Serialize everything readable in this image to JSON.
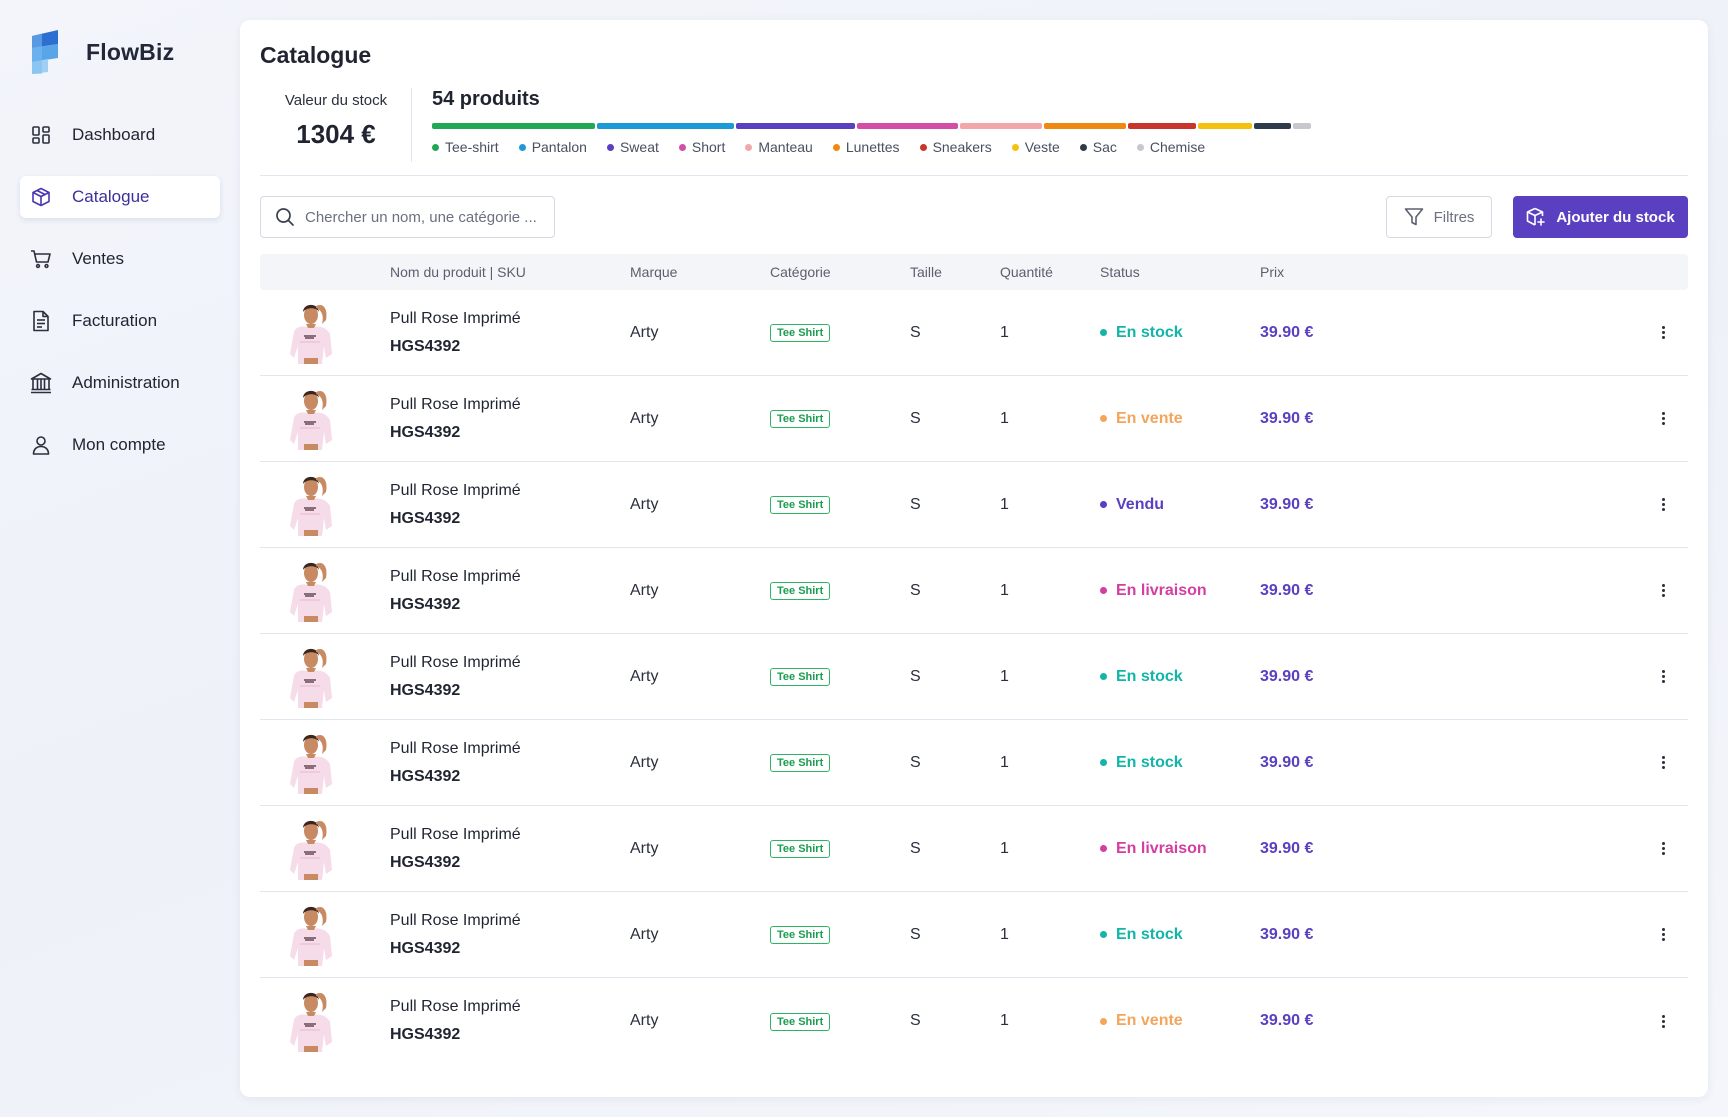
{
  "brand": {
    "name": "FlowBiz"
  },
  "nav": [
    {
      "label": "Dashboard",
      "icon": "dashboard-icon",
      "active": false
    },
    {
      "label": "Catalogue",
      "icon": "box-icon",
      "active": true
    },
    {
      "label": "Ventes",
      "icon": "cart-icon",
      "active": false
    },
    {
      "label": "Facturation",
      "icon": "document-icon",
      "active": false
    },
    {
      "label": "Administration",
      "icon": "bank-icon",
      "active": false
    },
    {
      "label": "Mon compte",
      "icon": "user-icon",
      "active": false
    }
  ],
  "page": {
    "title": "Catalogue"
  },
  "stock": {
    "label": "Valeur du stock",
    "value": "1304 €"
  },
  "products": {
    "count_label": "54 produits",
    "categories": [
      {
        "name": "Tee-shirt",
        "color": "#22a855",
        "share": 0.185
      },
      {
        "name": "Pantalon",
        "color": "#1c9ad6",
        "share": 0.155
      },
      {
        "name": "Sweat",
        "color": "#5a3fc0",
        "share": 0.135
      },
      {
        "name": "Short",
        "color": "#d24fa6",
        "share": 0.115
      },
      {
        "name": "Manteau",
        "color": "#f2a8a8",
        "share": 0.093
      },
      {
        "name": "Lunettes",
        "color": "#ee8a12",
        "share": 0.093
      },
      {
        "name": "Sneakers",
        "color": "#c8352c",
        "share": 0.077
      },
      {
        "name": "Veste",
        "color": "#f4c20d",
        "share": 0.061
      },
      {
        "name": "Sac",
        "color": "#2f3a4a",
        "share": 0.042
      },
      {
        "name": "Chemise",
        "color": "#c6c8ce",
        "share": 0.02
      }
    ]
  },
  "toolbar": {
    "search_placeholder": "Chercher un nom, une catégorie ...",
    "filter_label": "Filtres",
    "add_label": "Ajouter du stock"
  },
  "table": {
    "headers": {
      "name": "Nom du produit | SKU",
      "brand": "Marque",
      "category": "Catégorie",
      "size": "Taille",
      "quantity": "Quantité",
      "status": "Status",
      "price": "Prix"
    },
    "rows": [
      {
        "name": "Pull Rose Imprimé",
        "sku": "HGS4392",
        "brand": "Arty",
        "category": "Tee Shirt",
        "size": "S",
        "quantity": "1",
        "status": "En stock",
        "status_color": "#12b5a8",
        "price": "39.90 €"
      },
      {
        "name": "Pull Rose Imprimé",
        "sku": "HGS4392",
        "brand": "Arty",
        "category": "Tee Shirt",
        "size": "S",
        "quantity": "1",
        "status": "En vente",
        "status_color": "#f3a55b",
        "price": "39.90 €"
      },
      {
        "name": "Pull Rose Imprimé",
        "sku": "HGS4392",
        "brand": "Arty",
        "category": "Tee Shirt",
        "size": "S",
        "quantity": "1",
        "status": "Vendu",
        "status_color": "#5a3fc0",
        "price": "39.90 €"
      },
      {
        "name": "Pull Rose Imprimé",
        "sku": "HGS4392",
        "brand": "Arty",
        "category": "Tee Shirt",
        "size": "S",
        "quantity": "1",
        "status": "En livraison",
        "status_color": "#d23fa0",
        "price": "39.90 €"
      },
      {
        "name": "Pull Rose Imprimé",
        "sku": "HGS4392",
        "brand": "Arty",
        "category": "Tee Shirt",
        "size": "S",
        "quantity": "1",
        "status": "En stock",
        "status_color": "#12b5a8",
        "price": "39.90 €"
      },
      {
        "name": "Pull Rose Imprimé",
        "sku": "HGS4392",
        "brand": "Arty",
        "category": "Tee Shirt",
        "size": "S",
        "quantity": "1",
        "status": "En stock",
        "status_color": "#12b5a8",
        "price": "39.90 €"
      },
      {
        "name": "Pull Rose Imprimé",
        "sku": "HGS4392",
        "brand": "Arty",
        "category": "Tee Shirt",
        "size": "S",
        "quantity": "1",
        "status": "En livraison",
        "status_color": "#d23fa0",
        "price": "39.90 €"
      },
      {
        "name": "Pull Rose Imprimé",
        "sku": "HGS4392",
        "brand": "Arty",
        "category": "Tee Shirt",
        "size": "S",
        "quantity": "1",
        "status": "En stock",
        "status_color": "#12b5a8",
        "price": "39.90 €"
      },
      {
        "name": "Pull Rose Imprimé",
        "sku": "HGS4392",
        "brand": "Arty",
        "category": "Tee Shirt",
        "size": "S",
        "quantity": "1",
        "status": "En vente",
        "status_color": "#f3a55b",
        "price": "39.90 €"
      }
    ]
  }
}
